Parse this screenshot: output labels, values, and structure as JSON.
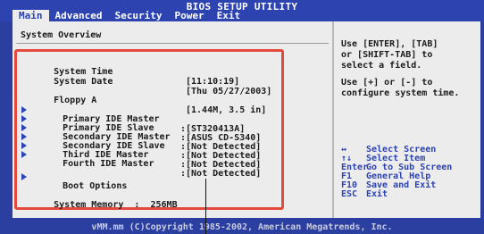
{
  "header": {
    "title": "BIOS SETUP UTILITY"
  },
  "menu": {
    "tabs": [
      "Main",
      "Advanced",
      "Security",
      "Power",
      "Exit"
    ],
    "active": "Main"
  },
  "main": {
    "section_title": "System Overview",
    "system_time_label": "System Time",
    "system_time_value": "[11:10:19]",
    "system_date_label": "System Date",
    "system_date_value": "[Thu 05/27/2003]",
    "floppy_label": "Floppy A",
    "floppy_value": "[1.44M, 3.5 in]",
    "ide": [
      {
        "label": "Primary IDE Master",
        "value": ":[ST320413A]"
      },
      {
        "label": "Primary IDE Slave",
        "value": ":[ASUS CD-S340]"
      },
      {
        "label": "Secondary IDE Master",
        "value": ":[Not Detected]"
      },
      {
        "label": "Secondary IDE Slave",
        "value": ":[Not Detected]"
      },
      {
        "label": "Third IDE Master",
        "value": ":[Not Detected]"
      },
      {
        "label": "Fourth IDE Master",
        "value": ":[Not Detected]"
      }
    ],
    "boot_options_label": "Boot Options",
    "system_memory": "System Memory  :  256MB"
  },
  "help": {
    "text1": "Use [ENTER], [TAB]\nor [SHIFT-TAB] to\nselect a field.",
    "text2": "Use [+] or [-] to\nconfigure system time.",
    "keys": [
      {
        "key": "↔",
        "desc": "Select Screen"
      },
      {
        "key": "↑↓",
        "desc": "Select Item"
      },
      {
        "key": "Enter",
        "desc": "Go to Sub Screen"
      },
      {
        "key": "F1",
        "desc": "General Help"
      },
      {
        "key": "F10",
        "desc": "Save and Exit"
      },
      {
        "key": "ESC",
        "desc": "Exit"
      }
    ]
  },
  "footer": {
    "text": "vMM.mm (C)Copyright 1985-2002, American Megatrends, Inc."
  },
  "colors": {
    "accent": "#2c43b0",
    "background": "#ececec",
    "highlight_box": "#e4493d"
  }
}
